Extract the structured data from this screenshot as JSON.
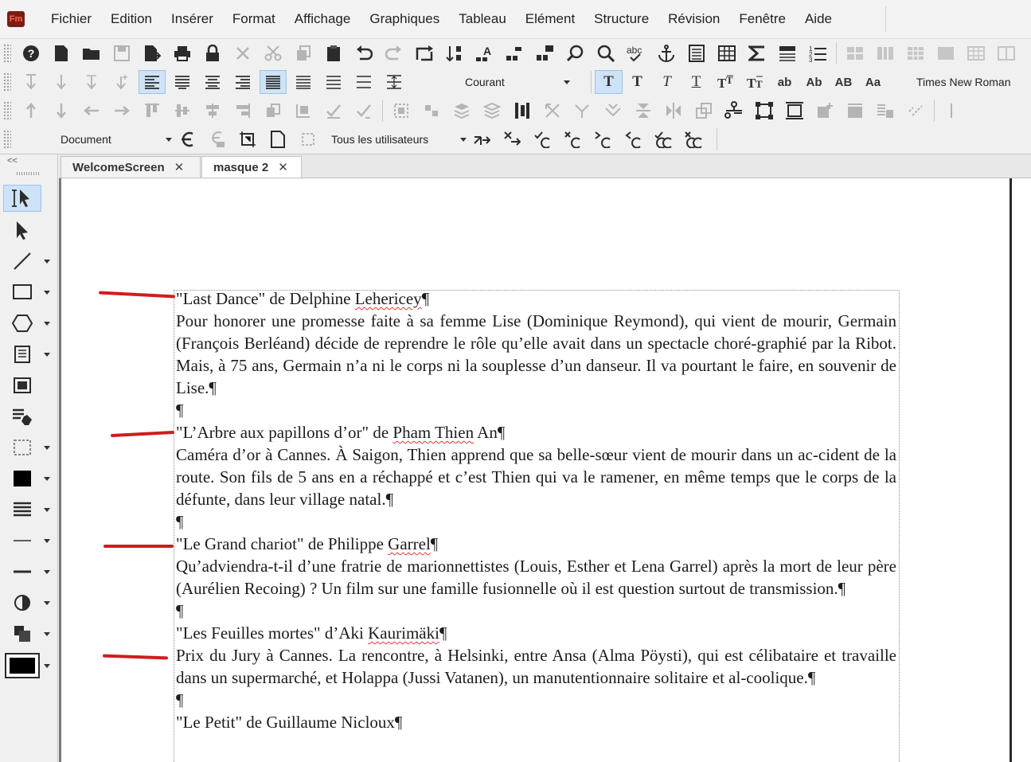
{
  "app": {
    "logo": "Fm"
  },
  "menu": [
    "Fichier",
    "Edition",
    "Insérer",
    "Format",
    "Affichage",
    "Graphiques",
    "Tableau",
    "Elément",
    "Structure",
    "Révision",
    "Fenêtre",
    "Aide"
  ],
  "toolbar": {
    "paragraph_style": "Courant",
    "font_name": "Times New Roman",
    "view": "Document",
    "users": "Tous les utilisateurs",
    "case_buttons": [
      "ab",
      "Ab",
      "AB",
      "Aa"
    ]
  },
  "tabs": [
    {
      "label": "WelcomeScreen",
      "close": "✕"
    },
    {
      "label": "masque 2",
      "close": "✕"
    }
  ],
  "left_panel": {
    "collapse": "<<"
  },
  "document": {
    "pilcrow": "¶",
    "entries": [
      {
        "title_parts": [
          "\"Last Dance\" de Delphine ",
          "Lehericey",
          "¶"
        ],
        "body": "Pour honorer une promesse faite à sa femme Lise (Dominique Reymond), qui vient de mourir, Germain (François Berléand) décide de reprendre le rôle qu’elle avait dans un spectacle choré-graphié par la Ribot. Mais, à 75 ans, Germain n’a ni le corps ni la souplesse d’un danseur. Il va pourtant le faire, en souvenir de Lise.¶"
      },
      {
        "title_parts": [
          "\"L’Arbre aux papillons d’or\" de ",
          "Pham Thien",
          " An¶"
        ],
        "body": "Caméra d’or à Cannes. À Saigon, Thien apprend que sa belle-sœur vient de mourir dans un ac-cident de la route. Son fils de 5 ans en a réchappé et c’est Thien qui va le ramener, en même temps que le corps de la défunte, dans leur village natal.¶"
      },
      {
        "title_parts": [
          "\"Le Grand chariot\" de Philippe ",
          "Garrel",
          "¶"
        ],
        "body": "Qu’adviendra-t-il d’une fratrie de marionnettistes (Louis, Esther et Lena Garrel) après la mort de leur père (Aurélien Recoing) ? Un film sur une famille fusionnelle où il est question surtout de transmission.¶"
      },
      {
        "title_parts": [
          "\"Les Feuilles mortes\" d’Aki ",
          "Kaurimäki",
          "¶"
        ],
        "body": "Prix du Jury à Cannes. La rencontre, à Helsinki, entre Ansa (Alma Pöysti), qui est célibataire et travaille dans un supermarché, et Holappa (Jussi Vatanen), un manutentionnaire solitaire et al-coolique.¶"
      }
    ],
    "partial_next": "\"Le Petit\" de Guillaume Nicloux¶"
  },
  "colors": {
    "annotation_marks": "#d11c1c",
    "active_tool_bg": "#cfe3f7",
    "logo_bg": "#7a1d14"
  }
}
